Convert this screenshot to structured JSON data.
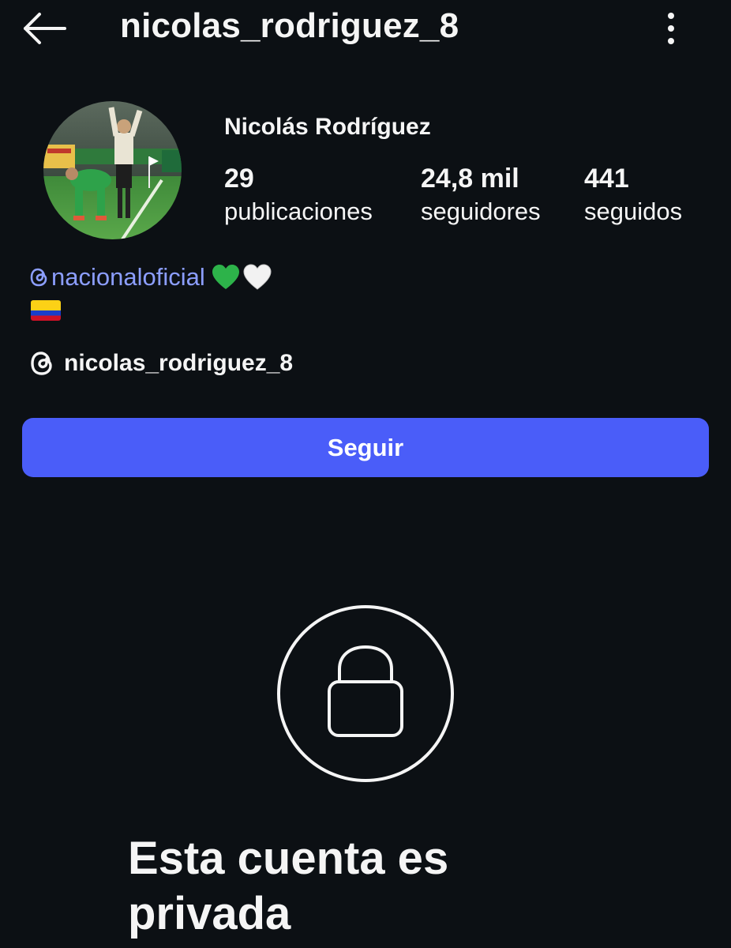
{
  "header": {
    "back_icon": "arrow-left-icon",
    "username": "nicolas_rodriguez_8",
    "more_icon": "more-vertical-icon"
  },
  "profile": {
    "full_name": "Nicolás Rodríguez",
    "avatar": "profile-photo",
    "stats": [
      {
        "value": "29",
        "label": "publicaciones"
      },
      {
        "value": "24,8 mil",
        "label": "seguidores"
      },
      {
        "value": "441",
        "label": "seguidos"
      }
    ]
  },
  "bio": {
    "mention": "nacionaloficial",
    "emoji_icons": [
      "green-heart-icon",
      "white-heart-icon"
    ],
    "flag_icon": "colombia-flag-icon",
    "threads_handle": "nicolas_rodriguez_8"
  },
  "actions": {
    "follow_label": "Seguir"
  },
  "private": {
    "icon": "lock-icon",
    "message": "Esta cuenta es privada"
  },
  "colors": {
    "background": "#0c1014",
    "accent_button": "#4a5df9",
    "link": "#8c9eff",
    "text": "#f5f5f5"
  }
}
